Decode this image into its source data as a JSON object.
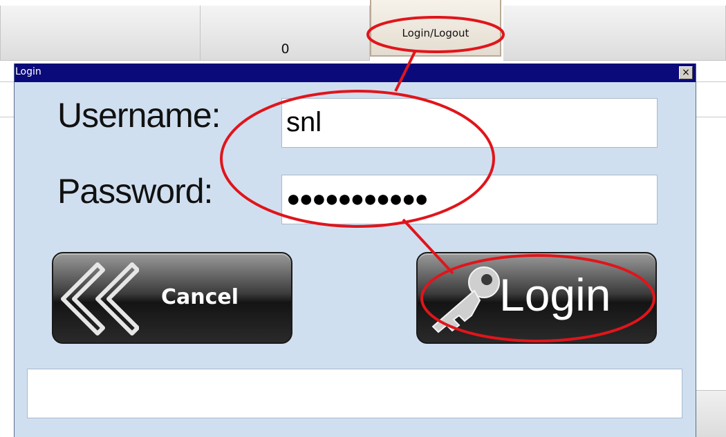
{
  "background": {
    "counter_value": "0",
    "login_logout_label": "Login/Logout"
  },
  "dialog": {
    "title": "Login",
    "close_glyph": "×",
    "username_label": "Username:",
    "username_value": "snl",
    "password_label": "Password:",
    "password_mask": "●●●●●●●●●●●",
    "cancel_label": "Cancel",
    "login_label": "Login",
    "status_text": ""
  },
  "icons": {
    "cancel": "double-chevron-left-icon",
    "login": "key-icon",
    "close": "close-icon"
  },
  "colors": {
    "titlebar": "#0b0a7a",
    "dialog_bg": "#d0dff0",
    "annotation": "#e0151b"
  }
}
